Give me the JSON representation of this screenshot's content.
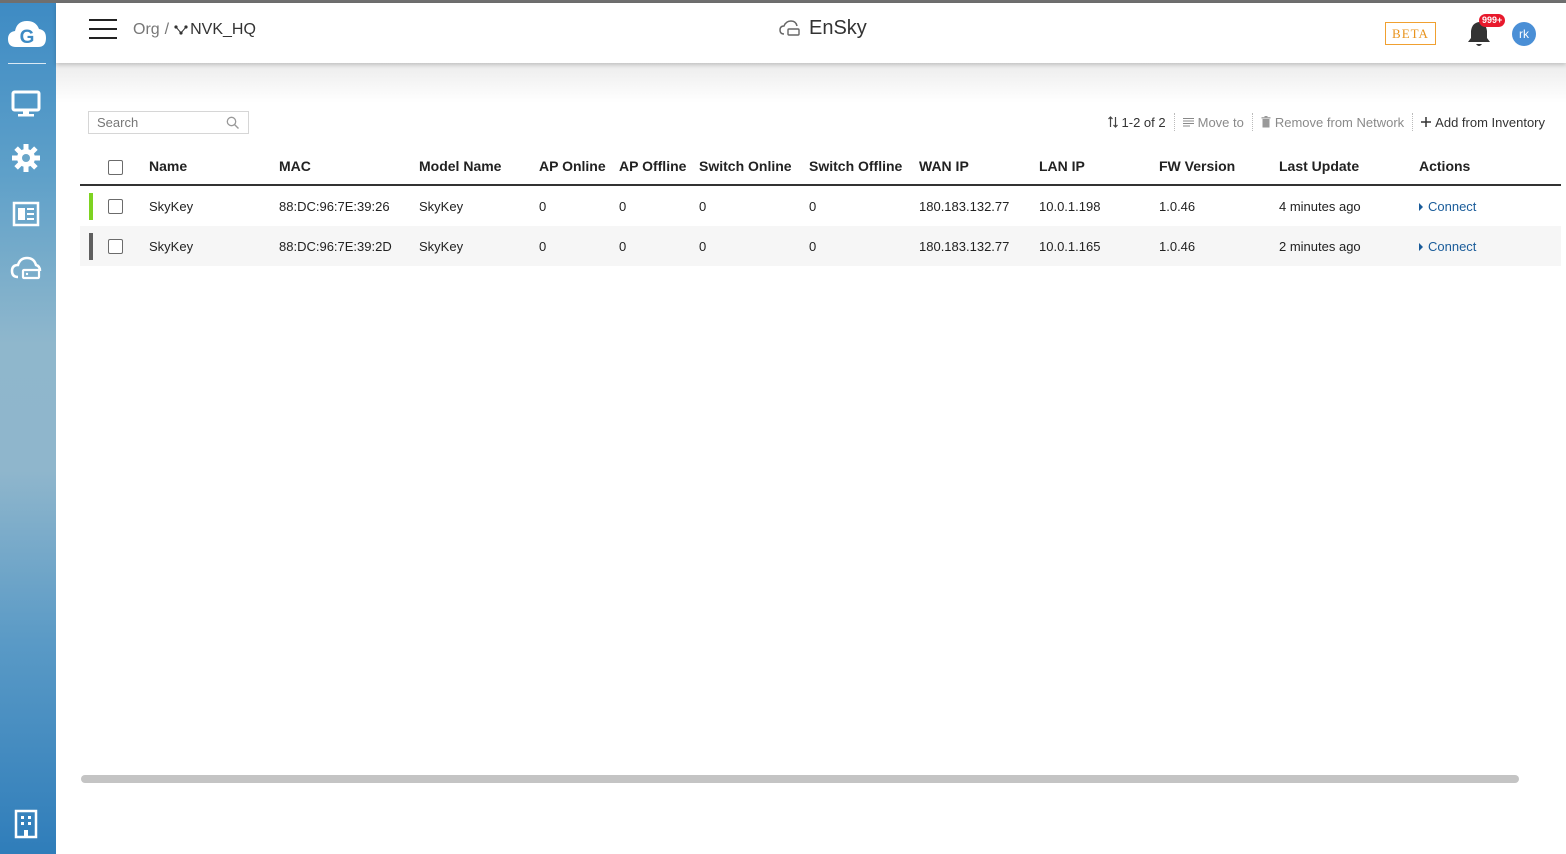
{
  "header": {
    "breadcrumb_org": "Org",
    "breadcrumb_sep": "/",
    "breadcrumb_network": "NVK_HQ",
    "app_title": "EnSky",
    "beta_label": "BETA",
    "notification_count": "999+",
    "avatar_initials": "rk"
  },
  "sidebar": {
    "items": [
      {
        "icon": "monitor-icon"
      },
      {
        "icon": "gear-icon"
      },
      {
        "icon": "dashboard-icon"
      },
      {
        "icon": "cloud-device-icon"
      },
      {
        "icon": "building-icon"
      }
    ]
  },
  "toolbar": {
    "search_placeholder": "Search",
    "pagination": "1-2 of 2",
    "move_to": "Move to",
    "remove": "Remove from Network",
    "add": "Add from Inventory"
  },
  "table": {
    "columns": [
      "Name",
      "MAC",
      "Model Name",
      "AP Online",
      "AP Offline",
      "Switch Online",
      "Switch Offline",
      "WAN IP",
      "LAN IP",
      "FW Version",
      "Last Update",
      "Actions"
    ],
    "rows": [
      {
        "status_color": "#7ed321",
        "name": "SkyKey",
        "mac": "88:DC:96:7E:39:26",
        "model": "SkyKey",
        "ap_online": "0",
        "ap_offline": "0",
        "switch_online": "0",
        "switch_offline": "0",
        "wan_ip": "180.183.132.77",
        "lan_ip": "10.0.1.198",
        "fw": "1.0.46",
        "last_update": "4 minutes ago",
        "action": "Connect"
      },
      {
        "status_color": "#5f5f5f",
        "name": "SkyKey",
        "mac": "88:DC:96:7E:39:2D",
        "model": "SkyKey",
        "ap_online": "0",
        "ap_offline": "0",
        "switch_online": "0",
        "switch_offline": "0",
        "wan_ip": "180.183.132.77",
        "lan_ip": "10.0.1.165",
        "fw": "1.0.46",
        "last_update": "2 minutes ago",
        "action": "Connect"
      }
    ]
  },
  "colors": {
    "accent": "#1a5c9a",
    "beta": "#e8931c",
    "badge": "#e8192c",
    "avatar": "#4a8fd6"
  }
}
